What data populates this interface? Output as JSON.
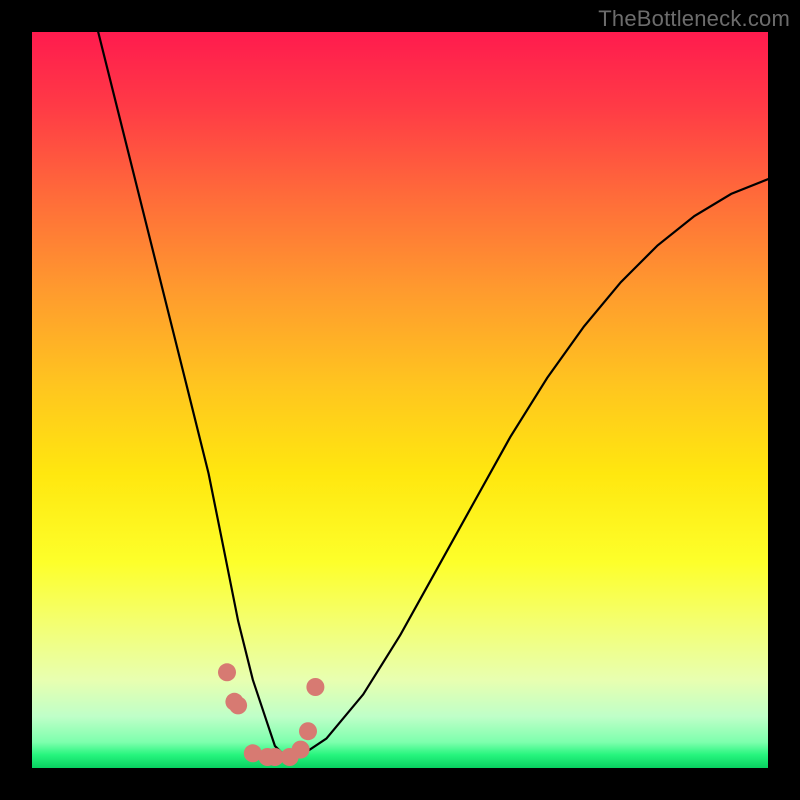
{
  "watermark": "TheBottleneck.com",
  "chart_data": {
    "type": "line",
    "title": "",
    "xlabel": "",
    "ylabel": "",
    "xlim": [
      0,
      100
    ],
    "ylim": [
      0,
      100
    ],
    "series": [
      {
        "name": "bottleneck-curve",
        "x": [
          9,
          12,
          15,
          18,
          21,
          24,
          26,
          28,
          30,
          32,
          33,
          35,
          37,
          40,
          45,
          50,
          55,
          60,
          65,
          70,
          75,
          80,
          85,
          90,
          95,
          100
        ],
        "values": [
          100,
          88,
          76,
          64,
          52,
          40,
          30,
          20,
          12,
          6,
          3,
          1,
          2,
          4,
          10,
          18,
          27,
          36,
          45,
          53,
          60,
          66,
          71,
          75,
          78,
          80
        ]
      }
    ],
    "markers": {
      "name": "salmon-dots",
      "color": "#d77a72",
      "x": [
        26.5,
        27.5,
        28,
        30,
        32,
        33,
        35,
        36.5,
        37.5,
        38.5
      ],
      "values": [
        13,
        9,
        8.5,
        2,
        1.5,
        1.5,
        1.5,
        2.5,
        5,
        11
      ]
    },
    "optimal_band": {
      "y_from": 0,
      "y_to": 3,
      "color": "#08d060"
    }
  },
  "colors": {
    "frame": "#000000",
    "curve": "#000000",
    "marker": "#d77a72",
    "watermark": "#6c6c6c"
  }
}
